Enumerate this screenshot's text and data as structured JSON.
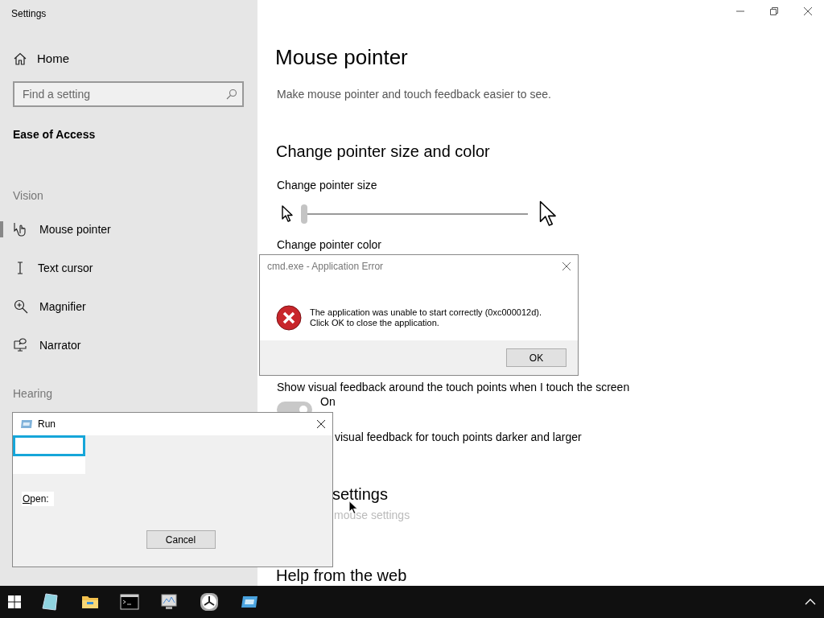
{
  "window": {
    "title": "Settings"
  },
  "sidebar": {
    "home": "Home",
    "search": {
      "placeholder": "Find a setting"
    },
    "category": "Ease of Access",
    "sections": [
      {
        "heading": "Vision",
        "items": [
          {
            "label": "Mouse pointer",
            "selected": true
          },
          {
            "label": "Text cursor",
            "selected": false
          },
          {
            "label": "Magnifier",
            "selected": false
          },
          {
            "label": "Narrator",
            "selected": false
          }
        ]
      },
      {
        "heading": "Hearing"
      }
    ]
  },
  "content": {
    "title": "Mouse pointer",
    "description": "Make mouse pointer and touch feedback easier to see.",
    "heading": "Change pointer size and color",
    "size_label": "Change pointer size",
    "size_slider": {
      "level": 0
    },
    "color_label": "Change pointer color",
    "touch_label": "Show visual feedback around the touch points when I touch the screen",
    "touch_toggle": {
      "on": true,
      "label": "On"
    },
    "touch_darker_label": "visual feedback for touch points darker and larger",
    "related_heading": "settings",
    "related_link": "mouse settings",
    "help_heading": "Help from the web"
  },
  "error_dialog": {
    "title": "cmd.exe - Application Error",
    "message": [
      "The application was unable to start correctly (0xc000012d).",
      "Click OK to close the application."
    ],
    "button": "OK"
  },
  "run_dialog": {
    "title": "Run",
    "open_label": "Open:",
    "button": "Cancel"
  }
}
